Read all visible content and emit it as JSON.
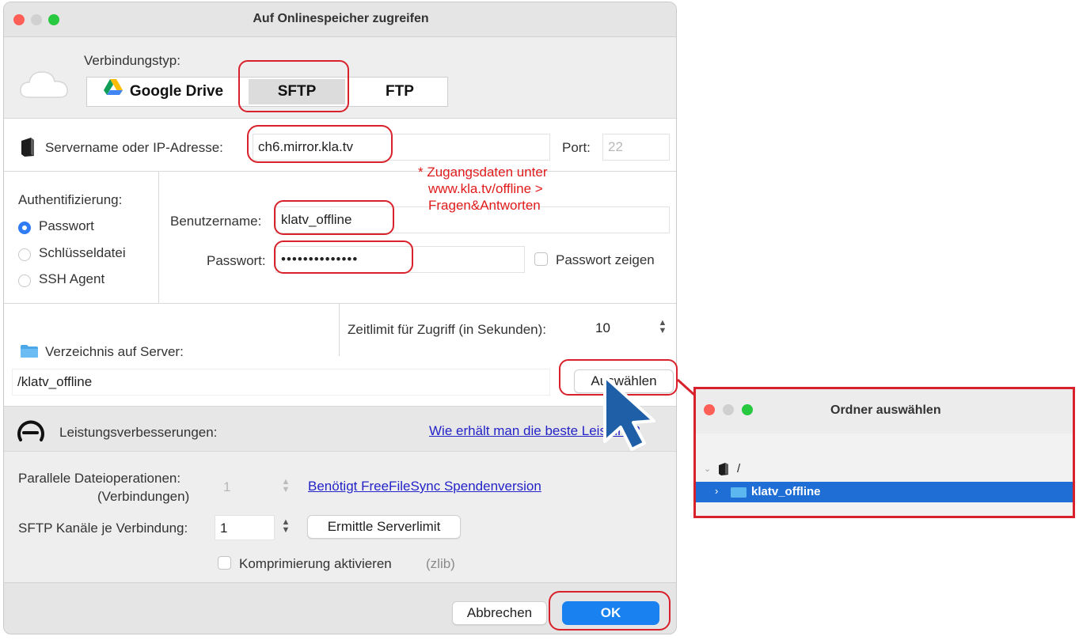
{
  "window": {
    "title": "Auf Onlinespeicher zugreifen"
  },
  "connection": {
    "label": "Verbindungstyp:",
    "options": [
      "Google Drive",
      "SFTP",
      "FTP"
    ],
    "selected": "SFTP"
  },
  "server": {
    "label": "Servername oder IP-Adresse:",
    "value": "ch6.mirror.kla.tv",
    "port_label": "Port:",
    "port_value": "22"
  },
  "note": {
    "line1": "* Zugangsdaten unter",
    "line2": "www.kla.tv/offline >",
    "line3": "Fragen&Antworten"
  },
  "auth": {
    "label": "Authentifizierung:",
    "options": [
      "Passwort",
      "Schlüsseldatei",
      "SSH Agent"
    ],
    "selected": "Passwort"
  },
  "credentials": {
    "username_label": "Benutzername:",
    "username_value": "klatv_offline",
    "password_label": "Passwort:",
    "password_value": "••••••••••••••",
    "show_password_label": "Passwort zeigen"
  },
  "timeout": {
    "label": "Zeitlimit für Zugriff (in Sekunden):",
    "value": "10"
  },
  "directory": {
    "label": "Verzeichnis auf Server:",
    "value": "/klatv_offline",
    "choose_label": "Auswählen"
  },
  "performance": {
    "label": "Leistungsverbesserungen:",
    "link": "Wie erhält man die beste Leistung?",
    "parallel_label_1": "Parallele Dateioperationen:",
    "parallel_label_2": "(Verbindungen)",
    "parallel_value": "1",
    "donation_link": "Benötigt FreeFileSync Spendenversion",
    "channels_label": "SFTP Kanäle je Verbindung:",
    "channels_value": "1",
    "server_limit_button": "Ermittle Serverlimit",
    "compress_label": "Komprimierung aktivieren",
    "compress_suffix": "(zlib)"
  },
  "footer": {
    "cancel": "Abbrechen",
    "ok": "OK"
  },
  "folder_dialog": {
    "title": "Ordner auswählen",
    "root": "/",
    "selected_folder": "klatv_offline"
  },
  "colors": {
    "annotation_red": "#d8212a",
    "accent_blue": "#1a82f0",
    "selection_blue": "#1f6ed6",
    "link_blue": "#2323c8",
    "note_red": "#e01b1b"
  }
}
